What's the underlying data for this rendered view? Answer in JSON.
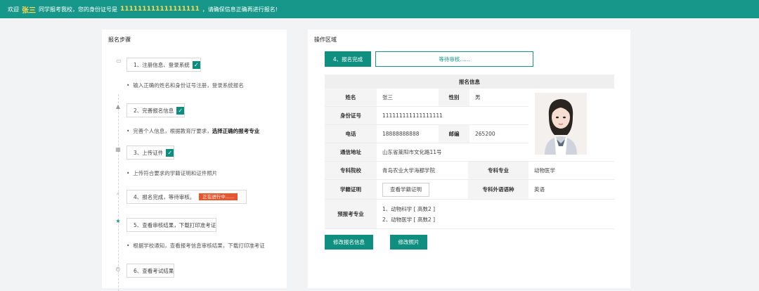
{
  "topbar": {
    "welcome": "欢迎",
    "name": "张三",
    "mid": "同学报考我校，您的身份证号是",
    "id_number": "111111111111111111",
    "tail": "，请确保信息正确再进行报名!"
  },
  "left": {
    "title": "报名步骤",
    "steps": [
      {
        "label": "1、注册信息、登录系统",
        "checked": "✓",
        "desc": "输入正确的姓名和身份证号注册，登录系统报名",
        "icon": "monitor-icon"
      },
      {
        "label": "2、完善报名信息",
        "checked": "✓",
        "desc_plain": "完善个人信息，根据教育厅要求，",
        "desc_bold": "选择正确的报考专业",
        "icon": "graduation-cap-icon"
      },
      {
        "label": "3、上传证件",
        "checked": "✓",
        "desc": "上传符合要求的学籍证明和证件照片",
        "icon": "id-card-icon"
      },
      {
        "label": "4、报名完成，等待审核。",
        "badge": "正在进行中......",
        "icon": "spinner-icon"
      },
      {
        "label": "5、查看审核结果，下载打印准考证",
        "desc": "根据学校通知，查看报考信息审核结果，下载打印准考证",
        "icon": "star-icon"
      },
      {
        "label": "6、查看考试结果",
        "icon": "clock-icon"
      }
    ]
  },
  "right": {
    "title": "操作区域",
    "step_button": "4、报名完成",
    "status": "等待审核......",
    "info_title": "报名信息",
    "fields": {
      "name_label": "姓名",
      "name_value": "张三",
      "gender_label": "性别",
      "gender_value": "男",
      "id_label": "身份证号",
      "id_value": "111111111111111111",
      "phone_label": "电话",
      "phone_value": "18888888888",
      "zip_label": "邮编",
      "zip_value": "265200",
      "address_label": "通信地址",
      "address_value": "山东省莱阳市文化路11号",
      "school_label": "专科院校",
      "school_value": "青岛农业大学海都学院",
      "major_label": "专科专业",
      "major_value": "动物医学",
      "cert_label": "学籍证明",
      "cert_button": "查看学籍证明",
      "lang_label": "专科外语语种",
      "lang_value": "英语",
      "apply_label": "预报考专业",
      "apply_majors": [
        "1、动物科学 [ 高数2 ]",
        "2、动物医学 [ 高数2 ]"
      ]
    },
    "edit_button": "修改报名信息",
    "photo_button": "修改照片"
  },
  "colors": {
    "accent": "#16978a",
    "badge": "#e8562f",
    "highlight": "#ffd84d"
  }
}
